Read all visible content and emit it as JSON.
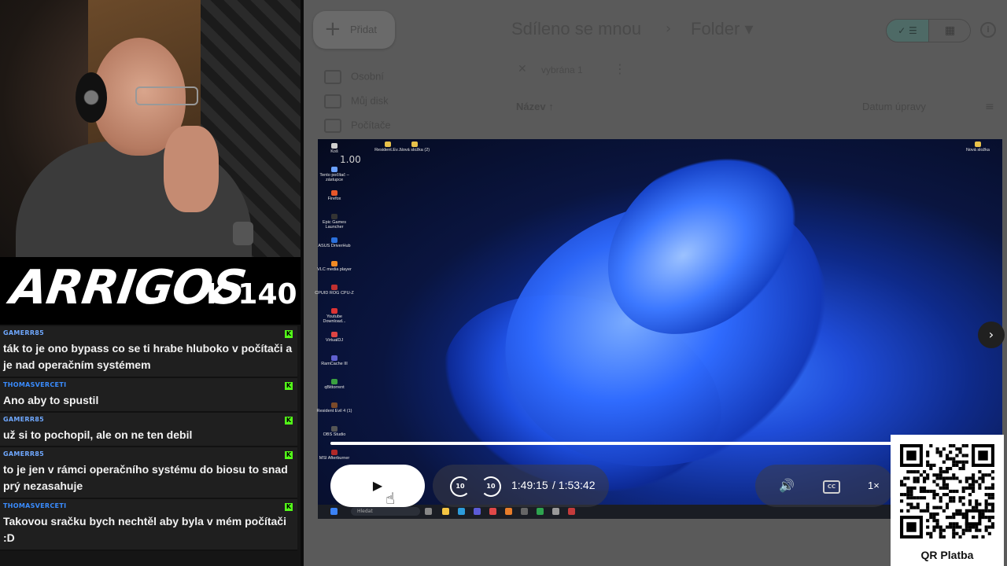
{
  "stream": {
    "brand_name": "ARRIGOS",
    "brand_badge": "K 140"
  },
  "chat": [
    {
      "user": "GAMERR85",
      "user_color": "#6fa8ff",
      "text": "ták to je ono bypass co se ti hrabe hluboko v počítači a je nad operačním systémem"
    },
    {
      "user": "THOMASVERCETI",
      "user_color": "#3a8cff",
      "text": "Ano aby to spustil"
    },
    {
      "user": "GAMERR85",
      "user_color": "#6fa8ff",
      "text": "už si to pochopil, ale on ne ten debil"
    },
    {
      "user": "GAMERR85",
      "user_color": "#6fa8ff",
      "text": "to je jen v rámci operačního systému do biosu to snad prý nezasahuje"
    },
    {
      "user": "THOMASVERCETI",
      "user_color": "#3a8cff",
      "text": "Takovou sračku bych nechtěl aby byla v mém počítači :D"
    }
  ],
  "drive": {
    "new_button": "Přidat",
    "nav": [
      "Osobní",
      "Můj disk",
      "Počítače"
    ],
    "breadcrumb_parent": "Sdíleno se mnou",
    "breadcrumb_sep": "›",
    "breadcrumb_current": "Folder ▾",
    "selection_text": "vybrána 1",
    "column_name": "Název ↑",
    "column_date": "Datum úpravy"
  },
  "video": {
    "overlay_number": "1.00",
    "desktop_icons": [
      "Koš",
      "Tento počítač – zástupce",
      "Firefox",
      "Epic Games Launcher",
      "ASUS DriverHub",
      "VLC media player",
      "CPUID ROG CPU-Z",
      "Youtube Download...",
      "VirtualDJ",
      "RamCache III",
      "qBittorrent",
      "Resident Evil 4 (1)",
      "OBS Studio",
      "MSI Afterburner"
    ],
    "top_icons": [
      "Resident.Ev...",
      "Nová složka (2)"
    ],
    "right_icon": "Nová složka",
    "taskbar_search": "Hledat",
    "current_time": "1:49:15",
    "total_time": "/ 1:53:42",
    "progress_fraction": 0.9613,
    "speed": "1×",
    "rewind_seconds": "10",
    "forward_seconds": "10",
    "cc_label": "CC"
  },
  "qr": {
    "label": "QR Platba"
  },
  "icons": {
    "play": "▶",
    "volume": "🔊",
    "next": "›",
    "close": "✕",
    "more": "⋮",
    "plus": "+",
    "info": "i",
    "sort": "≡",
    "hand_cursor": "☝"
  }
}
